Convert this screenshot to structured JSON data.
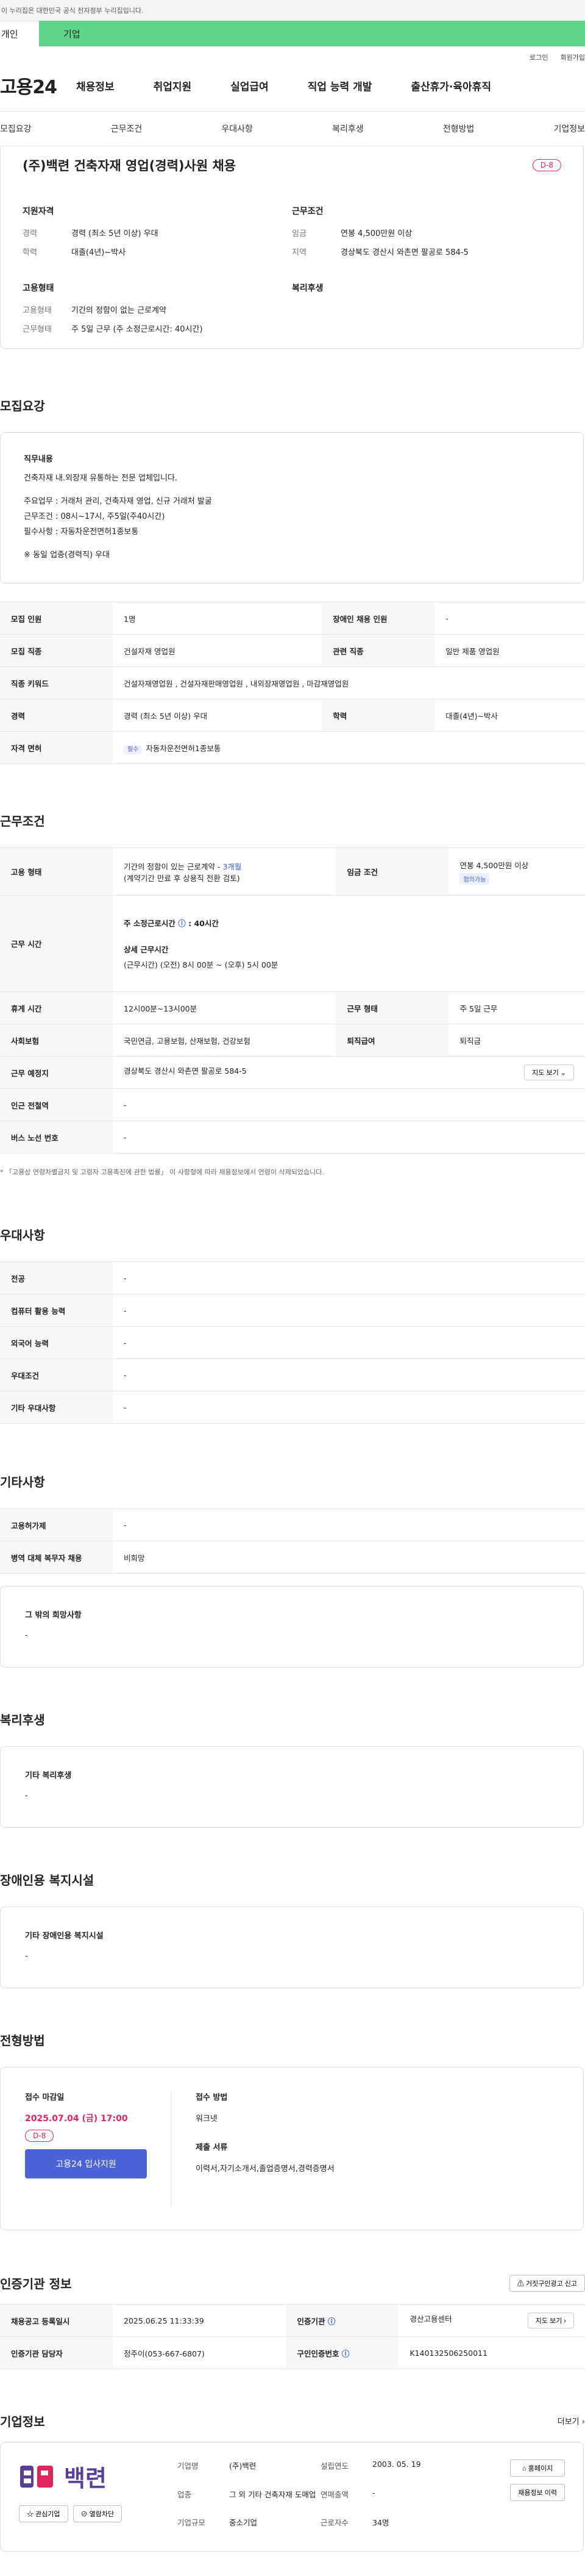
{
  "notice": "이 누리집은 대한민국 공식 전자정부 누리집입니다.",
  "role_tabs": [
    "개인",
    "기업"
  ],
  "top_links": [
    "로그인",
    "회원가입"
  ],
  "logo": "고용24",
  "gnb": [
    "채용정보",
    "취업지원",
    "실업급여",
    "직업 능력 개발",
    "출산휴가·육아휴직"
  ],
  "anchor_tabs": [
    "모집요강",
    "근무조건",
    "우대사항",
    "복리후생",
    "전형방법",
    "기업정보"
  ],
  "summary": {
    "title": "(주)백련 건축자재 영업(경력)사원 채용",
    "dday": "D-8",
    "qual_head": "지원자격",
    "qual": [
      [
        "경력",
        "경력 (최소 5년 이상) 우대"
      ],
      [
        "학력",
        "대졸(4년)~박사"
      ]
    ],
    "cond_head": "근무조건",
    "cond": [
      [
        "임금",
        "연봉 4,500만원 이상"
      ],
      [
        "지역",
        "경상북도 경산시 와촌면 팔공로 584-5"
      ]
    ],
    "emp_head": "고용형태",
    "emp": [
      [
        "고용형태",
        "기간의 정함이 없는 근로계약"
      ],
      [
        "근무형태",
        "주 5일 근무 (주 소정근로시간: 40시간)"
      ]
    ],
    "welfare_head": "복리후생"
  },
  "recruit": {
    "title": "모집요강",
    "desc_head": "직무내용",
    "desc_lines": [
      "건축자재 내.외장재 유통하는 전문 업체입니다.",
      "",
      "주요업무 : 거래처 관리, 건축자재 영업, 신규 거래처 발굴",
      "근무조건 : 08시~17시, 주5일(주40시간)",
      "필수사항 : 자동차운전면허1종보통",
      "",
      "※ 동일 업종(경력직) 우대"
    ],
    "rows": {
      "headcount_k": "모집 인원",
      "headcount_v": "1명",
      "disabled_k": "장애인 채용 인원",
      "disabled_v": "-",
      "job_k": "모집 직종",
      "job_v": "건설자재 영업원",
      "related_k": "관련 직종",
      "related_v": "일반 제품 영업원",
      "keyword_k": "직종 키워드",
      "keyword_v": "건설자재영업원 , 건설자재판매영업원 , 내외장재영업원 , 마감재영업원",
      "career_k": "경력",
      "career_v": "경력 (최소 5년 이상) 우대",
      "edu_k": "학력",
      "edu_v": "대졸(4년)~박사",
      "license_k": "자격 면허",
      "license_badge": "필수",
      "license_v": "자동차운전면허1종보통"
    }
  },
  "work": {
    "title": "근무조건",
    "type_k": "고용 형태",
    "type_v1": "기간의 정함이 있는 근로계약 - ",
    "type_v1_b": "3개월",
    "type_v2": "(계약기간 만료 후 상용직 전환 검토)",
    "wage_k": "임금 조건",
    "wage_v": "연봉 4,500만원 이상",
    "wage_badge": "협의가능",
    "hours_k": "근무 시간",
    "hours_v1": "주 소정근로시간",
    "hours_v1_b": ": 40시간",
    "hours_v2": "상세 근무시간",
    "hours_v3": "(근무시간) (오전) 8시 00분 ~ (오후) 5시 00분",
    "rest_k": "휴게 시간",
    "rest_v": "12시00분~13시00분",
    "form_k": "근무 형태",
    "form_v": "주 5일 근무",
    "ins_k": "사회보험",
    "ins_v": "국민연금, 고용보험, 산재보험, 건강보험",
    "sev_k": "퇴직급여",
    "sev_v": "퇴직금",
    "place_k": "근무 예정지",
    "place_v": "경상북도 경산시 와촌면 팔공로 584-5",
    "map_btn": "지도 보기",
    "station_k": "인근 전철역",
    "station_v": "-",
    "bus_k": "버스 노선 번호",
    "bus_v": "-",
    "footnote": "* 「고용상 연령차별금지 및 고령자 고용촉진에 관한 법률」 이 사항형에 따라 채용정보에서 연령이 삭제되었습니다."
  },
  "pref": {
    "title": "우대사항",
    "rows": [
      [
        "전공",
        "-"
      ],
      [
        "컴퓨터 활용 능력",
        "-"
      ],
      [
        "외국어 능력",
        "-"
      ],
      [
        "우대조건",
        "-"
      ],
      [
        "기타 우대사항",
        "-"
      ]
    ]
  },
  "etc": {
    "title": "기타사항",
    "rows": [
      [
        "고용허가제",
        "-"
      ],
      [
        "병역 대체 복무자 채용",
        "비희망"
      ]
    ],
    "other_head": "그 밖의 희망사항",
    "other_v": "-"
  },
  "welfare": {
    "title": "복리후생",
    "head": "기타 복리후생",
    "value": "-"
  },
  "disabled": {
    "title": "장애인용 복지시설",
    "head": "기타 장애인용 복지시설",
    "value": "-"
  },
  "process": {
    "title": "전형방법",
    "deadline_h": "접수 마감일",
    "deadline": "2025.07.04 (금) 17:00",
    "dday": "D-8",
    "apply_btn": "고용24 입사지원",
    "method_h": "접수 방법",
    "method_v": "워크넷",
    "docs_h": "제출 서류",
    "docs_v": "이력서,자기소개서,졸업증명서,경력증명서"
  },
  "agency": {
    "title": "인증기관 정보",
    "report_btn": "거짓구인광고 신고",
    "reg_k": "채용공고 등록일시",
    "reg_v": "2025.06.25 11:33:39",
    "org_k": "인증기관",
    "org_v": "경산고용센터",
    "map_btn": "지도 보기",
    "staff_k": "인증기관 담당자",
    "staff_v": "정주이(053-667-6807)",
    "num_k": "구인인증번호",
    "num_v": "K140132506250011"
  },
  "company": {
    "title": "기업정보",
    "more": "더보기",
    "logo_text": "백련",
    "interest_btn": "관심기업",
    "block_btn": "열람차단",
    "name_k": "기업명",
    "name_v": "(주)백련",
    "founded_k": "설립연도",
    "founded_v": "2003. 05. 19",
    "industry_k": "업종",
    "industry_v": "그 외 기타 건축자재 도매업",
    "sales_k": "연매출액",
    "sales_v": "-",
    "emp_k": "근로자수",
    "emp_v": "34명",
    "size_k": "기업규모",
    "size_v": "중소기업",
    "home_btn": "홈페이지",
    "history_btn": "채용정보 이력"
  }
}
